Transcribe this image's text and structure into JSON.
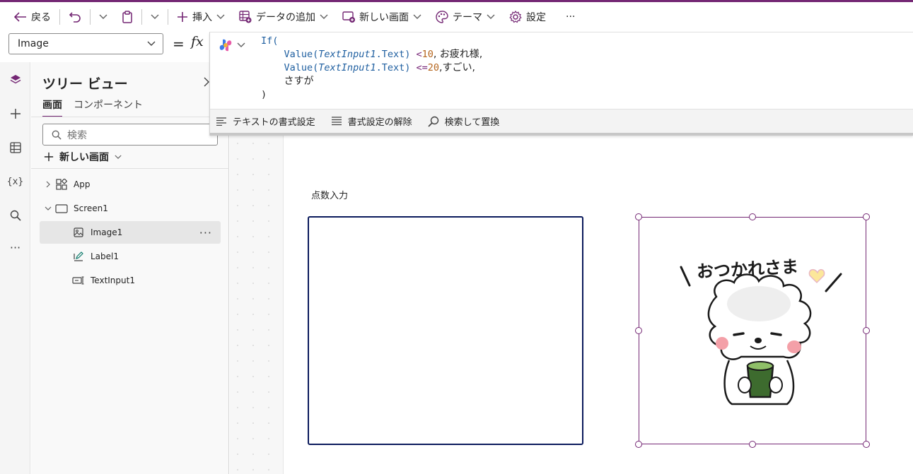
{
  "toolbar": {
    "back_label": "戻る",
    "insert_label": "挿入",
    "add_data_label": "データの追加",
    "new_screen_label": "新しい画面",
    "theme_label": "テーマ",
    "settings_label": "設定",
    "more_label": "···"
  },
  "formula_bar": {
    "property": "Image",
    "equals": "=",
    "fx": "fx",
    "code": {
      "l1": "If(",
      "value_fn": "Value(",
      "ctrl": "TextInput1",
      "dot_text": ".Text)",
      "op1": " <",
      "num1": "10",
      "res1": ", お疲れ様,",
      "op2": " <=",
      "num2": "20",
      "res2": ",すごい,",
      "else": "さすが",
      "close": ")"
    },
    "format_text_label": "テキストの書式設定",
    "remove_format_label": "書式設定の解除",
    "find_replace_label": "検索して置換"
  },
  "tree": {
    "title": "ツリー ビュー",
    "tabs": [
      "画面",
      "コンポーネント"
    ],
    "search_placeholder": "検索",
    "new_screen_label": "新しい画面",
    "nodes": {
      "app": "App",
      "screen": "Screen1",
      "image": "Image1",
      "label": "Label1",
      "textinput": "TextInput1"
    },
    "more": "···"
  },
  "canvas": {
    "label_text": "点数入力",
    "sticker_text": "おつかれさま"
  },
  "colors": {
    "accent": "#742774",
    "input_border": "#0b1a5c"
  }
}
